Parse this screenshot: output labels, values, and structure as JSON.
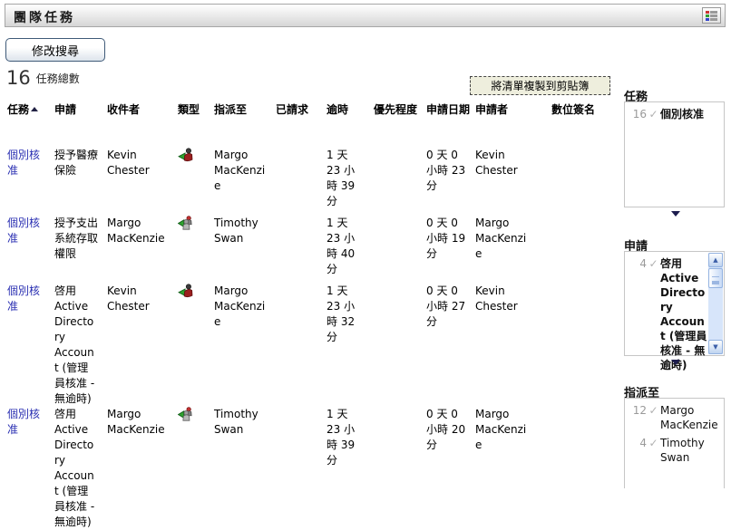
{
  "header": {
    "title": "團隊任務"
  },
  "toolbar": {
    "modify_search_label": "修改搜尋"
  },
  "summary": {
    "count": "16",
    "count_label": "任務總數",
    "copy_button_label": "將清單複製到剪貼簿"
  },
  "icons": {
    "check": "✓",
    "scroll_up": "▲",
    "scroll_down": "▼"
  },
  "colors": {
    "link_blue": "#2a2fb2",
    "copy_button_bg": "#eeeedd",
    "muted_count_gray": "#9a9a9a",
    "legend_red": "#cc3333",
    "legend_green": "#33a033",
    "legend_blue": "#3344cc"
  },
  "table": {
    "columns": [
      {
        "label": "任務",
        "sorted": "asc"
      },
      {
        "label": "申請"
      },
      {
        "label": "收件者"
      },
      {
        "label": "類型"
      },
      {
        "label": "指派至"
      },
      {
        "label": "已請求"
      },
      {
        "label": "逾時"
      },
      {
        "label": "優先程度"
      },
      {
        "label": "申請日期"
      },
      {
        "label": "申請者"
      },
      {
        "label": "數位簽名"
      }
    ],
    "rows": [
      {
        "task": "個別核准",
        "request": "授予醫療保險",
        "recipient": "Kevin Chester",
        "type_icon": "user-task-flag",
        "assigned_to": "Margo MacKenzie",
        "requested": "",
        "timeout": "1 天 23 小時 39 分",
        "priority": "",
        "request_date": "0 天 0 小時 23 分",
        "requester": "Kevin Chester",
        "signature": ""
      },
      {
        "task": "個別核准",
        "request": "授予支出系統存取權限",
        "recipient": "Margo MacKenzie",
        "type_icon": "group-task-flag",
        "assigned_to": "Timothy Swan",
        "requested": "",
        "timeout": "1 天 23 小時 40 分",
        "priority": "",
        "request_date": "0 天 0 小時 19 分",
        "requester": "Margo MacKenzie",
        "signature": ""
      },
      {
        "task": "個別核准",
        "request": "啓用 Active Directory Account (管理員核准 - 無逾時)",
        "recipient": "Kevin Chester",
        "type_icon": "user-task-flag",
        "assigned_to": "Margo MacKenzie",
        "requested": "",
        "timeout": "1 天 23 小時 32 分",
        "priority": "",
        "request_date": "0 天 0 小時 27 分",
        "requester": "Kevin Chester",
        "signature": ""
      },
      {
        "task": "個別核准",
        "request": "啓用 Active Directory Account (管理員核准 - 無逾時)",
        "recipient": "Margo MacKenzie",
        "type_icon": "group-task-flag",
        "assigned_to": "Timothy Swan",
        "requested": "",
        "timeout": "1 天 23 小時 39 分",
        "priority": "",
        "request_date": "0 天 0 小時 20 分",
        "requester": "Margo MacKenzie",
        "signature": ""
      }
    ]
  },
  "filters": {
    "tasks": {
      "title": "任務",
      "items": [
        {
          "count": "16",
          "label": "個別核准"
        }
      ]
    },
    "requests": {
      "title": "申請",
      "items": [
        {
          "count": "4",
          "label": "啓用 Active Directory Account (管理員核准 - 無逾時)"
        }
      ]
    },
    "assigned": {
      "title": "指派至",
      "items": [
        {
          "count": "12",
          "label": "Margo MacKenzie"
        },
        {
          "count": "4",
          "label": "Timothy Swan"
        }
      ]
    }
  }
}
